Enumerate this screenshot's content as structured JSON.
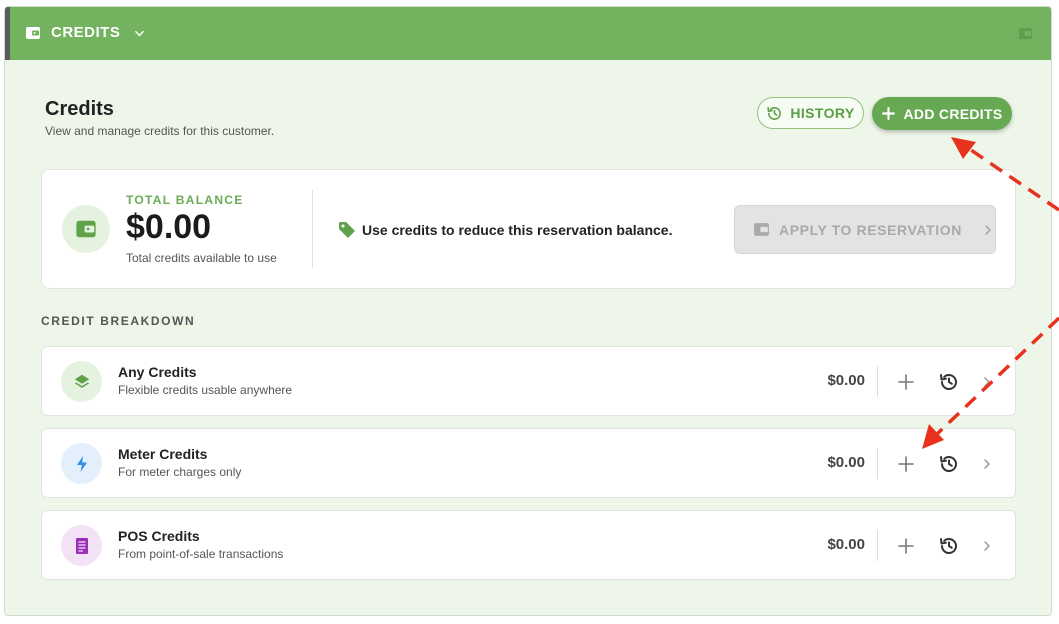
{
  "header": {
    "title": "CREDITS",
    "icon": "wallet-icon",
    "dropdown_icon": "chevron-down-icon",
    "right_icon": "wallet-icon"
  },
  "page": {
    "title": "Credits",
    "subtitle": "View and manage credits for this customer."
  },
  "actions": {
    "history_label": "HISTORY",
    "add_credits_label": "ADD CREDITS"
  },
  "balance": {
    "label": "TOTAL BALANCE",
    "amount": "$0.00",
    "sub": "Total credits available to use",
    "promo": "Use credits to reduce this reservation balance.",
    "apply_label": "APPLY TO RESERVATION"
  },
  "breakdown": {
    "label": "CREDIT BREAKDOWN",
    "rows": [
      {
        "title": "Any Credits",
        "desc": "Flexible credits usable anywhere",
        "amount": "$0.00",
        "icon": "layers-icon",
        "icon_color": "#5fa24a",
        "icon_bg": "#e6f2e0"
      },
      {
        "title": "Meter Credits",
        "desc": "For meter charges only",
        "amount": "$0.00",
        "icon": "lightning-icon",
        "icon_color": "#2f8de4",
        "icon_bg": "#e3f0fb"
      },
      {
        "title": "POS Credits",
        "desc": "From point-of-sale transactions",
        "amount": "$0.00",
        "icon": "receipt-icon",
        "icon_color": "#9b2fb7",
        "icon_bg": "#f3e2f6"
      }
    ]
  },
  "colors": {
    "header_green": "#73b35f",
    "accent_green": "#67a952",
    "annotation_red": "#e8321e"
  }
}
